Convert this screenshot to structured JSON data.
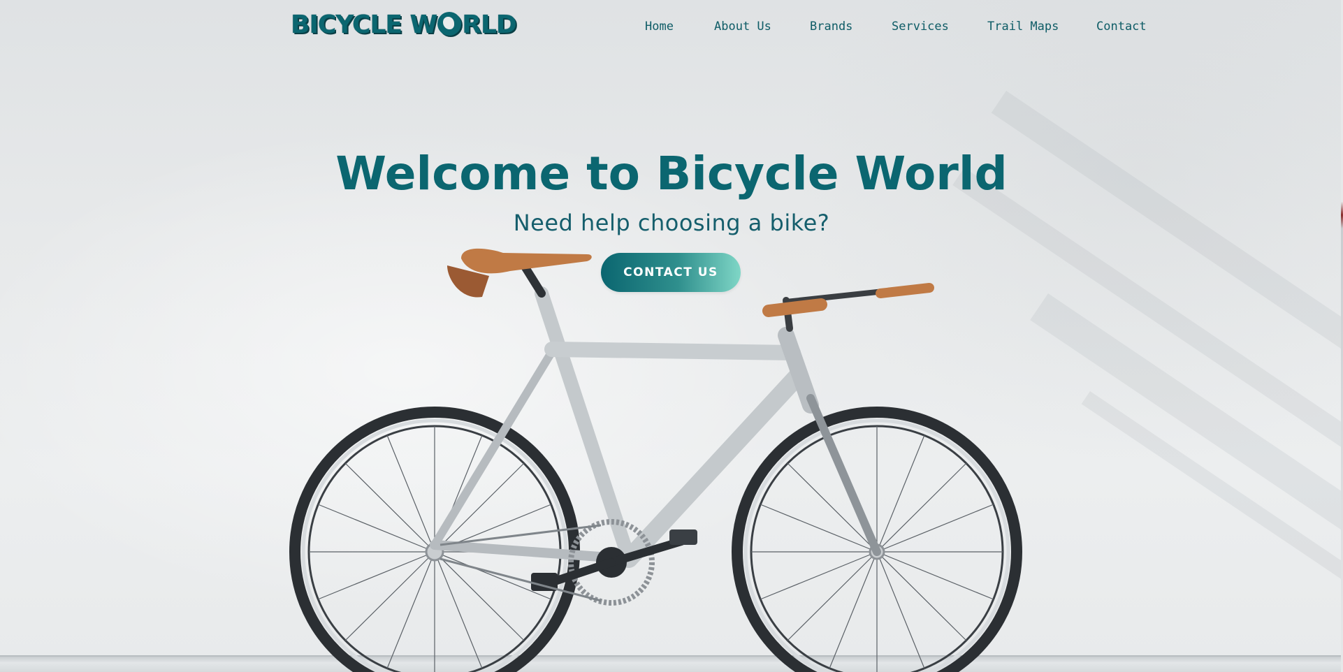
{
  "site": {
    "logo_text_before": "BICYCLE W",
    "logo_text_after": "RLD",
    "logo_icon": "globe-icon"
  },
  "nav": {
    "items": [
      {
        "label": "Home"
      },
      {
        "label": "About Us"
      },
      {
        "label": "Brands"
      },
      {
        "label": "Services"
      },
      {
        "label": "Trail Maps"
      },
      {
        "label": "Contact"
      }
    ]
  },
  "hero": {
    "title": "Welcome to Bicycle World",
    "subtitle": "Need help choosing a bike?",
    "cta_label": "CONTACT US",
    "background_image": "bicycle-leaning-on-white-wall"
  },
  "colors": {
    "brand": "#0b6670",
    "brand_dark": "#0a3f46",
    "cta_gradient_start": "#0b6670",
    "cta_gradient_end": "#7fd6c6",
    "leather": "#c07a45"
  }
}
